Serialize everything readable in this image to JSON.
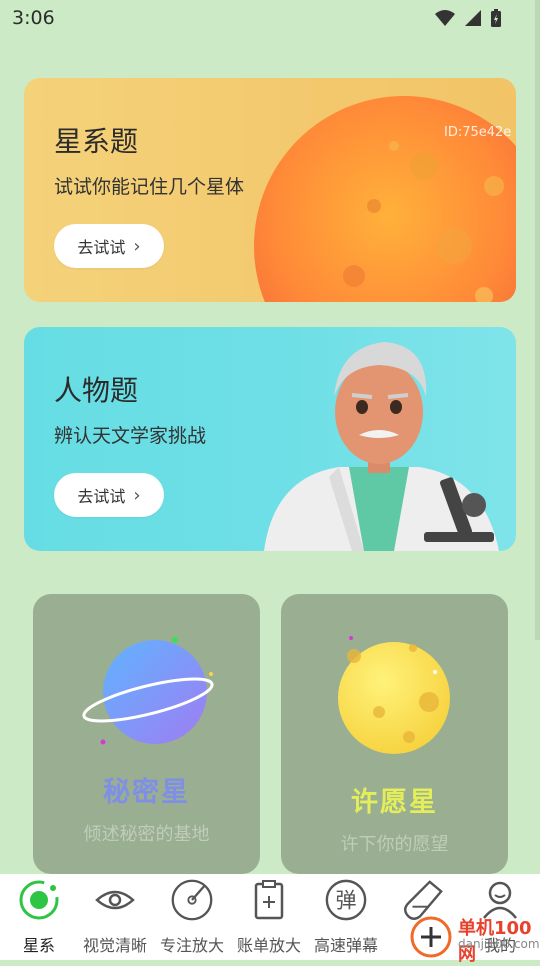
{
  "status_bar": {
    "time": "3:06"
  },
  "cards": [
    {
      "title": "星系题",
      "subtitle": "试试你能记住几个星体",
      "button": "去试试",
      "button_icon": "chevron-right-icon"
    },
    {
      "title": "人物题",
      "subtitle": "辨认天文学家挑战",
      "button": "去试试",
      "button_icon": "chevron-right-icon"
    }
  ],
  "watermark": "ID:75e42e",
  "tiles": [
    {
      "name": "秘密星",
      "desc": "倾述秘密的基地",
      "name_color": "#7f8fe6"
    },
    {
      "name": "许愿星",
      "desc": "许下你的愿望",
      "name_color": "#e3ee5a"
    }
  ],
  "bottom_nav": [
    {
      "label": "星系",
      "icon": "galaxy-icon",
      "active": true
    },
    {
      "label": "视觉清晰",
      "icon": "eye-icon"
    },
    {
      "label": "专注放大",
      "icon": "focus-dial-icon"
    },
    {
      "label": "账单放大",
      "icon": "bill-icon"
    },
    {
      "label": "高速弹幕",
      "icon": "danmaku-icon"
    },
    {
      "label": "单机100网",
      "icon": "flask-icon"
    },
    {
      "label": "我的",
      "icon": "profile-icon"
    }
  ],
  "corner_logo": {
    "line1": "单机100网",
    "line2": "danji100.com"
  },
  "colors": {
    "accent_green": "#2ec444",
    "card_star": "#f3ca6e",
    "card_people": "#6cdde5",
    "tile": "#9aae92"
  }
}
